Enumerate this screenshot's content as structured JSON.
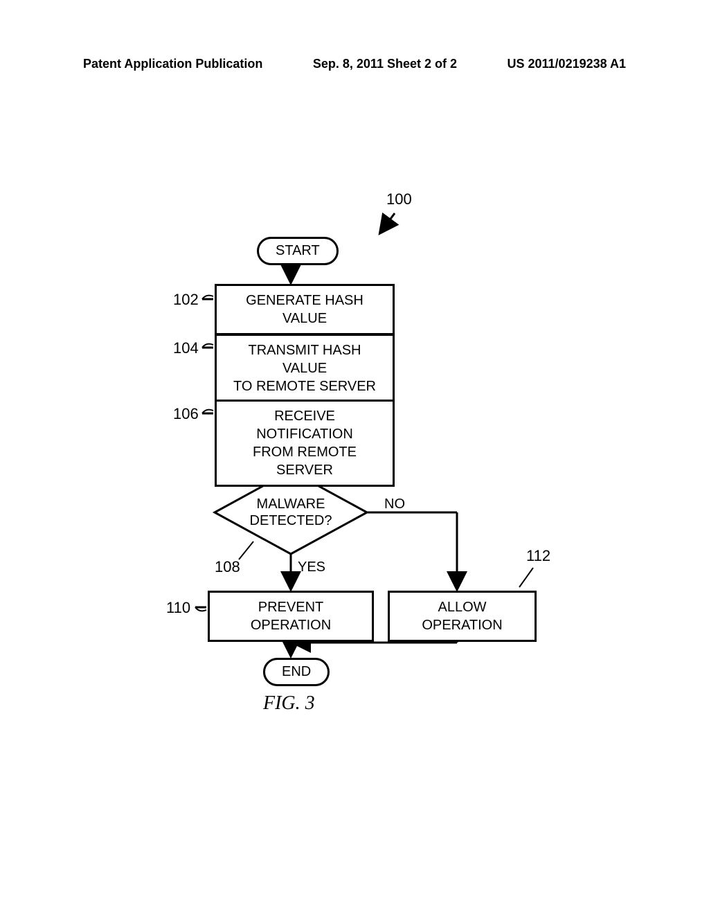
{
  "header": {
    "left": "Patent Application Publication",
    "center": "Sep. 8, 2011  Sheet 2 of 2",
    "right": "US 2011/0219238 A1"
  },
  "flowchart": {
    "reference": "100",
    "start": "START",
    "step102": {
      "ref": "102",
      "text": "GENERATE HASH VALUE"
    },
    "step104": {
      "ref": "104",
      "text": "TRANSMIT HASH VALUE\nTO REMOTE SERVER"
    },
    "step106": {
      "ref": "106",
      "text": "RECEIVE NOTIFICATION\nFROM REMOTE SERVER"
    },
    "decision": {
      "ref": "108",
      "text": "MALWARE\nDETECTED?",
      "yes": "YES",
      "no": "NO"
    },
    "step110": {
      "ref": "110",
      "text": "PREVENT OPERATION"
    },
    "step112": {
      "ref": "112",
      "text": "ALLOW OPERATION"
    },
    "end": "END"
  },
  "caption": "FIG. 3"
}
